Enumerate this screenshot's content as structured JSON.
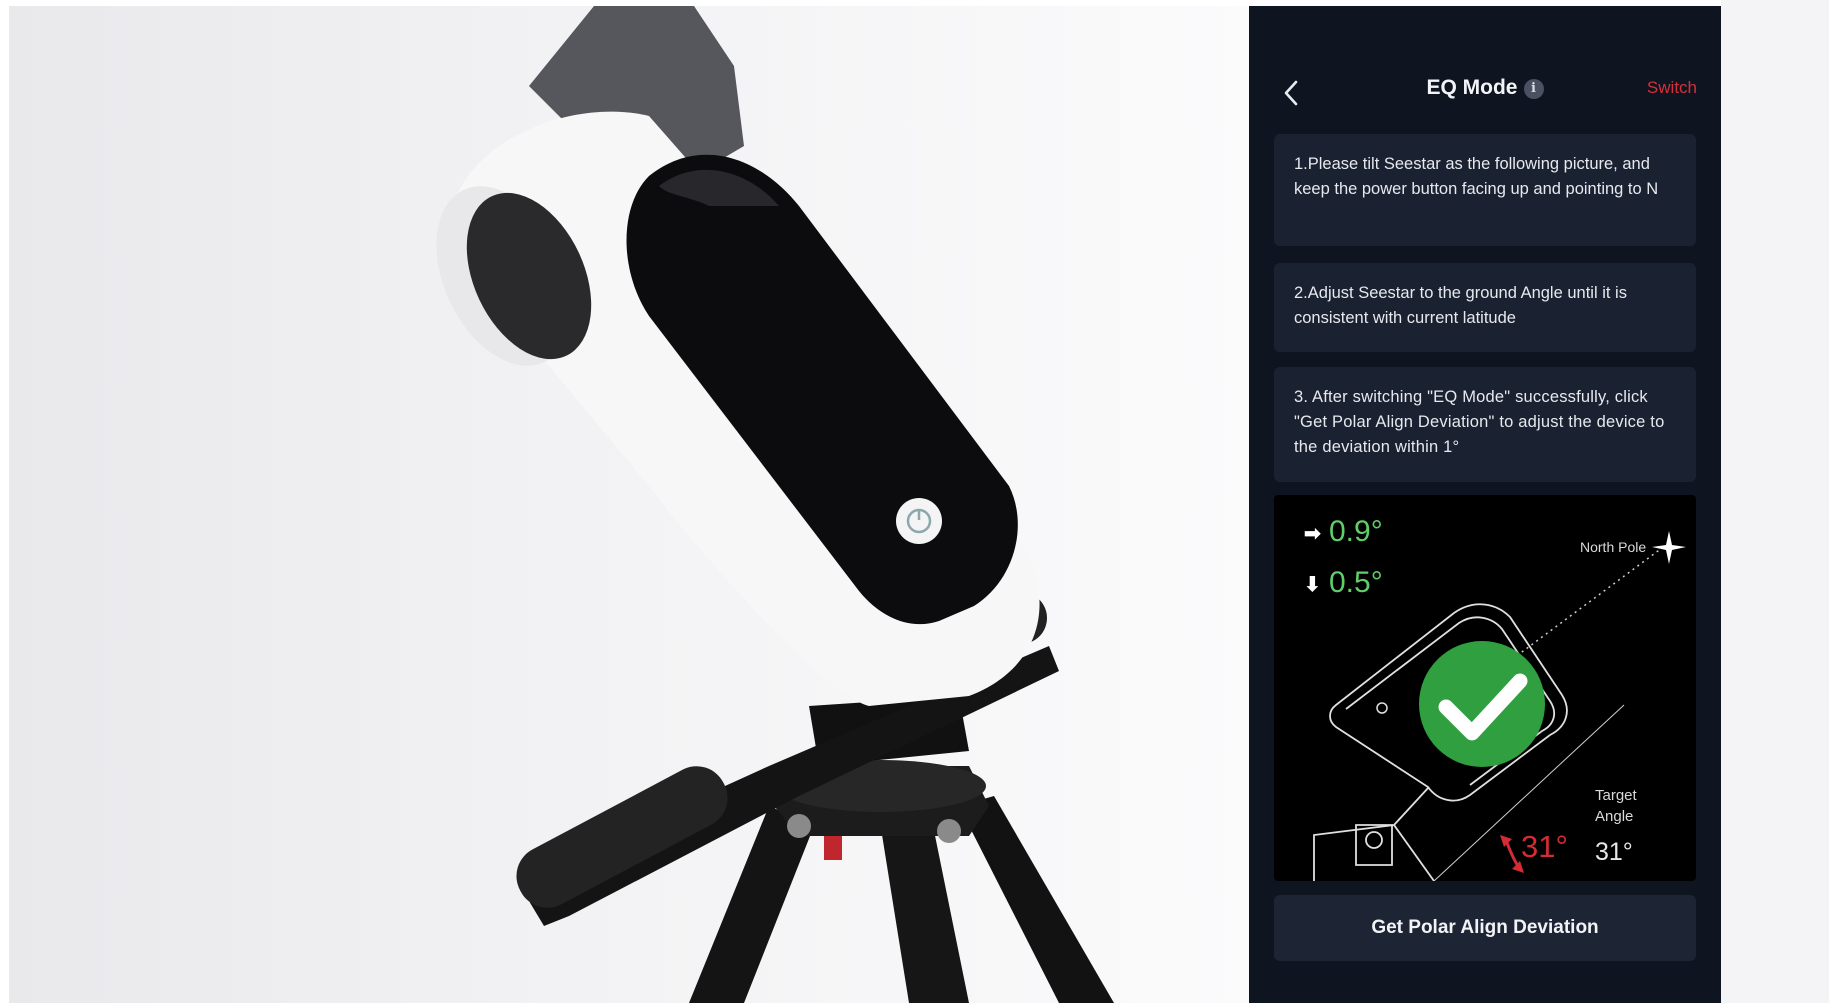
{
  "header": {
    "title": "EQ Mode",
    "info_icon": "i",
    "switch_label": "Switch"
  },
  "steps": [
    "1.Please tilt Seestar as the following picture, and keep the power button facing up and pointing to N",
    "2.Adjust Seestar to the ground Angle until it is consistent with current latitude",
    "3. After switching \"EQ Mode\" successfully, click \"Get Polar Align Deviation\" to adjust the device to the deviation within 1°"
  ],
  "diagram": {
    "horizontal_deviation": "0.9°",
    "vertical_deviation": "0.5°",
    "right_arrow": "➡",
    "down_arrow": "⬇",
    "north_pole_label": "North Pole",
    "target_angle_label_line1": "Target",
    "target_angle_label_line2": "Angle",
    "target_angle_value": "31°",
    "current_angle_value": "31°",
    "status": "aligned"
  },
  "action": {
    "button_label": "Get Polar Align Deviation"
  },
  "colors": {
    "panel_bg": "#0f1520",
    "card_bg": "#1a2130",
    "accent_red": "#d3303a",
    "success_green": "#2f9f3f",
    "deviation_green": "#5fce6a"
  },
  "icons": {
    "back": "chevron-left-icon",
    "info": "info-icon",
    "check": "checkmark-icon",
    "north_star": "star-icon"
  }
}
